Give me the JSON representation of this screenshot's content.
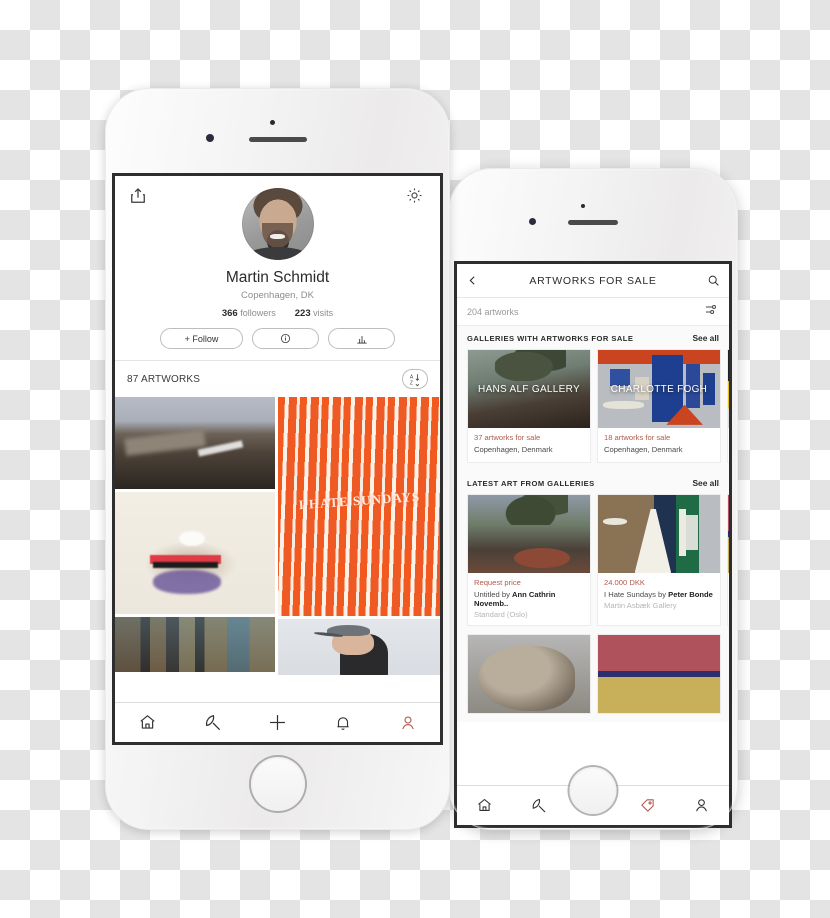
{
  "phone_front": {
    "profile": {
      "share_icon": "share-icon",
      "settings_icon": "gear-icon",
      "name": "Martin Schmidt",
      "location": "Copenhagen, DK",
      "followers_count": "366",
      "followers_label": "followers",
      "visits_count": "223",
      "visits_label": "visits",
      "follow_button": "+ Follow",
      "info_icon": "info-icon",
      "stats_icon": "bar-chart-icon"
    },
    "artworks_header": {
      "count_label": "87 ARTWORKS",
      "sort_icon": "sort-az-icon"
    },
    "grid": [
      {
        "name": "mountain-landscape-photo"
      },
      {
        "name": "lips-painting"
      },
      {
        "name": "abstract-stripes-painting"
      },
      {
        "name": "i-hate-sundays-orange-painting",
        "overlay_text": "I HATE SUNDAYS"
      },
      {
        "name": "swimmer-photo"
      }
    ],
    "tabbar": [
      {
        "name": "home-icon",
        "active": false
      },
      {
        "name": "explore-icon",
        "active": false
      },
      {
        "name": "plus-icon",
        "active": false
      },
      {
        "name": "bell-icon",
        "active": false
      },
      {
        "name": "profile-icon",
        "active": true
      }
    ]
  },
  "phone_back": {
    "nav": {
      "back_icon": "chevron-left-icon",
      "title": "ARTWORKS FOR SALE",
      "search_icon": "search-icon"
    },
    "subbar": {
      "count": "204 artworks",
      "filter_icon": "filter-sliders-icon"
    },
    "sections": [
      {
        "title": "GALLERIES WITH ARTWORKS FOR SALE",
        "see_all": "See all",
        "cards": [
          {
            "image_name": "hans-alf-gallery-artwork",
            "overlay": "HANS ALF GALLERY",
            "line1": "37 artworks for sale",
            "line2": "",
            "line3": "Copenhagen, Denmark"
          },
          {
            "image_name": "charlotte-fogh-gallery-artwork",
            "overlay": "CHARLOTTE FOGH",
            "line1": "18 artworks for sale",
            "line2": "",
            "line3": "Copenhagen, Denmark"
          },
          {
            "image_name": "third-gallery-artwork",
            "overlay": "",
            "line1": "",
            "line2": "",
            "line3": ""
          }
        ]
      },
      {
        "title": "LATEST ART FROM GALLERIES",
        "see_all": "See all",
        "cards": [
          {
            "image_name": "norwegian-landscape-painting",
            "overlay": "",
            "line1": "Request price",
            "line2_plain": "Untitled by ",
            "line2_bold": "Ann Cathrin Novemb..",
            "line3": "Standard (Oslo)"
          },
          {
            "image_name": "i-hate-sundays-painting",
            "overlay": "",
            "line1": "24.000 DKK",
            "line2_plain": "I Hate Sundays by ",
            "line2_bold": "Peter Bonde",
            "line3": "Martin Asbæk Gallery"
          },
          {
            "image_name": "stone-sculpture-photo",
            "overlay": "",
            "line1": "",
            "line2_plain": "",
            "line2_bold": "",
            "line3": ""
          },
          {
            "image_name": "striped-painting",
            "overlay": "",
            "line1": "",
            "line2_plain": "",
            "line2_bold": "",
            "line3": ""
          }
        ]
      }
    ],
    "tabbar": [
      {
        "name": "home-icon",
        "active": false
      },
      {
        "name": "explore-icon",
        "active": false
      },
      {
        "name": "plus-icon",
        "active": false
      },
      {
        "name": "tag-icon",
        "active": true
      },
      {
        "name": "profile-icon",
        "active": false
      }
    ]
  },
  "colors": {
    "accent_red": "#b05a4e",
    "text_primary": "#2b2b2b",
    "text_muted": "#9a9a9a"
  }
}
